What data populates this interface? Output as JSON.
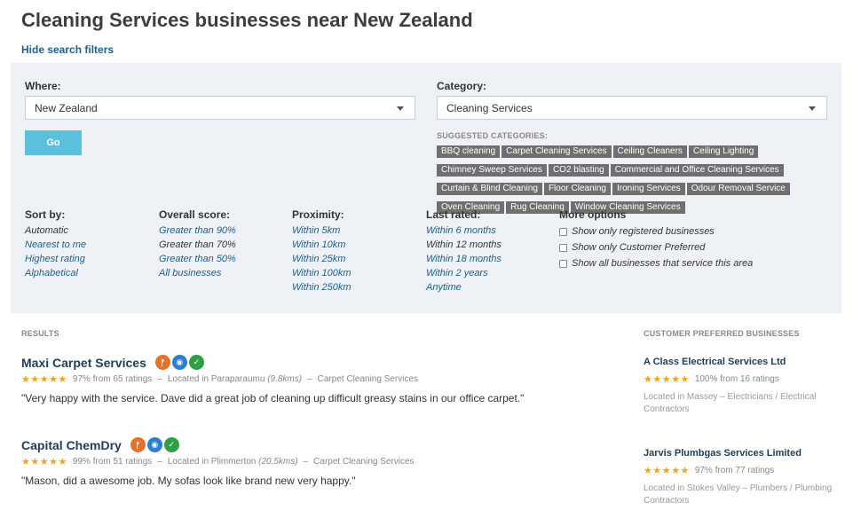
{
  "page_title": "Cleaning Services businesses near New Zealand",
  "hide_filters_label": "Hide search filters",
  "where": {
    "label": "Where:",
    "value": "New Zealand"
  },
  "category": {
    "label": "Category:",
    "value": "Cleaning Services"
  },
  "go_label": "Go",
  "suggested": {
    "title": "SUGGESTED CATEGORIES:",
    "tags": [
      "BBQ cleaning",
      "Carpet Cleaning Services",
      "Ceiling Cleaners",
      "Ceiling Lighting",
      "Chimney Sweep Services",
      "CO2 blasting",
      "Commercial and Office Cleaning Services",
      "Curtain & Blind Cleaning",
      "Floor Cleaning",
      "Ironing Services",
      "Odour Removal Service",
      "Oven Cleaning",
      "Rug Cleaning",
      "Window Cleaning Services"
    ]
  },
  "filters": {
    "sort_by": {
      "title": "Sort by:",
      "options": [
        "Automatic",
        "Nearest to me",
        "Highest rating",
        "Alphabetical"
      ],
      "active": "Automatic"
    },
    "overall_score": {
      "title": "Overall score:",
      "options": [
        "Greater than 90%",
        "Greater than 70%",
        "Greater than 50%",
        "All businesses"
      ],
      "active": "Greater than 70%"
    },
    "proximity": {
      "title": "Proximity:",
      "options": [
        "Within 5km",
        "Within 10km",
        "Within 25km",
        "Within 100km",
        "Within 250km"
      ],
      "active": ""
    },
    "last_rated": {
      "title": "Last rated:",
      "options": [
        "Within 6 months",
        "Within 12 months",
        "Within 18 months",
        "Within 2 years",
        "Anytime"
      ],
      "active": "Within 12 months"
    },
    "more_options": {
      "title": "More options",
      "options": [
        "Show only registered businesses",
        "Show only Customer Preferred",
        "Show all businesses that service this area"
      ]
    }
  },
  "results_heading": "RESULTS",
  "results": [
    {
      "name": "Maxi Carpet Services",
      "stars": "★★★★★",
      "rating_text": "97% from 65 ratings",
      "location_prefix": "Located in Paraparaumu",
      "distance": "(9.8kms)",
      "category": "Carpet Cleaning Services",
      "quote": "\"Very happy with the service. Dave did a great job of cleaning up difficult greasy stains in our office carpet.\"",
      "badges": [
        "fire-badge-icon",
        "globe-badge-icon",
        "check-badge-icon"
      ]
    },
    {
      "name": "Capital ChemDry",
      "stars": "★★★★★",
      "rating_text": "99% from 51 ratings",
      "location_prefix": "Located in Plimmerton",
      "distance": "(20.5kms)",
      "category": "Carpet Cleaning Services",
      "quote": "\"Mason, did a awesome job. My sofas look like brand new very happy.\"",
      "badges": [
        "fire-badge-icon",
        "globe-badge-icon",
        "check-badge-icon"
      ]
    }
  ],
  "cp_heading": "CUSTOMER PREFERRED BUSINESSES",
  "customer_preferred": [
    {
      "name": "A Class Electrical Services Ltd",
      "stars": "★★★★★",
      "rating_text": "100% from 16 ratings",
      "location": "Located in Massey  –  Electricians / Electrical Contractors"
    },
    {
      "name": "Jarvis Plumbgas Services Limited",
      "stars": "★★★★★",
      "rating_text": "97% from 77 ratings",
      "location": "Located in Stokes Valley  –  Plumbers / Plumbing Contractors"
    }
  ],
  "colors": {
    "link": "#1f5f8b",
    "go_button": "#5bc0de",
    "panel_bg": "#eef2f6",
    "star": "#f2a31c",
    "tag_bg": "#6f6f6f"
  }
}
